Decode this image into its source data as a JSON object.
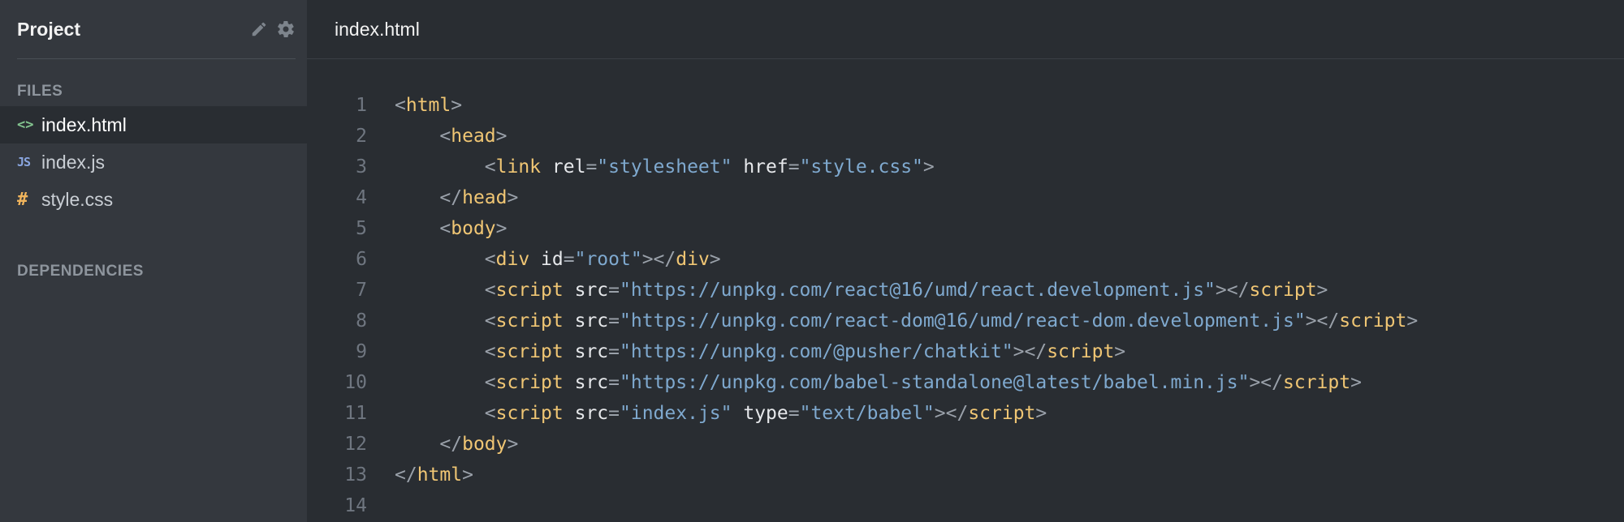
{
  "sidebar": {
    "title": "Project",
    "files_label": "FILES",
    "dependencies_label": "DEPENDENCIES",
    "files": [
      {
        "icon": "<>",
        "name": "index.html",
        "active": true
      },
      {
        "icon": "JS",
        "name": "index.js",
        "active": false
      },
      {
        "icon": "#",
        "name": "style.css",
        "active": false
      }
    ]
  },
  "editor": {
    "tab_title": "index.html",
    "lines": [
      {
        "n": "1",
        "indent": 0,
        "tokens": [
          [
            "p",
            "<"
          ],
          [
            "t",
            "html"
          ],
          [
            "p",
            ">"
          ]
        ]
      },
      {
        "n": "2",
        "indent": 1,
        "tokens": [
          [
            "p",
            "<"
          ],
          [
            "t",
            "head"
          ],
          [
            "p",
            ">"
          ]
        ]
      },
      {
        "n": "3",
        "indent": 2,
        "tokens": [
          [
            "p",
            "<"
          ],
          [
            "t",
            "link"
          ],
          [
            "p",
            " "
          ],
          [
            "a",
            "rel"
          ],
          [
            "p",
            "="
          ],
          [
            "s",
            "\"stylesheet\""
          ],
          [
            "p",
            " "
          ],
          [
            "a",
            "href"
          ],
          [
            "p",
            "="
          ],
          [
            "s",
            "\"style.css\""
          ],
          [
            "p",
            ">"
          ]
        ]
      },
      {
        "n": "4",
        "indent": 1,
        "tokens": [
          [
            "p",
            "</"
          ],
          [
            "t",
            "head"
          ],
          [
            "p",
            ">"
          ]
        ]
      },
      {
        "n": "5",
        "indent": 1,
        "tokens": [
          [
            "p",
            "<"
          ],
          [
            "t",
            "body"
          ],
          [
            "p",
            ">"
          ]
        ]
      },
      {
        "n": "6",
        "indent": 2,
        "tokens": [
          [
            "p",
            "<"
          ],
          [
            "t",
            "div"
          ],
          [
            "p",
            " "
          ],
          [
            "a",
            "id"
          ],
          [
            "p",
            "="
          ],
          [
            "s",
            "\"root\""
          ],
          [
            "p",
            "></"
          ],
          [
            "t",
            "div"
          ],
          [
            "p",
            ">"
          ]
        ]
      },
      {
        "n": "7",
        "indent": 2,
        "tokens": [
          [
            "p",
            "<"
          ],
          [
            "t",
            "script"
          ],
          [
            "p",
            " "
          ],
          [
            "a",
            "src"
          ],
          [
            "p",
            "="
          ],
          [
            "s",
            "\"https://unpkg.com/react@16/umd/react.development.js\""
          ],
          [
            "p",
            "></"
          ],
          [
            "t",
            "script"
          ],
          [
            "p",
            ">"
          ]
        ]
      },
      {
        "n": "8",
        "indent": 2,
        "tokens": [
          [
            "p",
            "<"
          ],
          [
            "t",
            "script"
          ],
          [
            "p",
            " "
          ],
          [
            "a",
            "src"
          ],
          [
            "p",
            "="
          ],
          [
            "s",
            "\"https://unpkg.com/react-dom@16/umd/react-dom.development.js\""
          ],
          [
            "p",
            "></"
          ],
          [
            "t",
            "script"
          ],
          [
            "p",
            ">"
          ]
        ]
      },
      {
        "n": "9",
        "indent": 2,
        "tokens": [
          [
            "p",
            "<"
          ],
          [
            "t",
            "script"
          ],
          [
            "p",
            " "
          ],
          [
            "a",
            "src"
          ],
          [
            "p",
            "="
          ],
          [
            "s",
            "\"https://unpkg.com/@pusher/chatkit\""
          ],
          [
            "p",
            "></"
          ],
          [
            "t",
            "script"
          ],
          [
            "p",
            ">"
          ]
        ]
      },
      {
        "n": "10",
        "indent": 2,
        "tokens": [
          [
            "p",
            "<"
          ],
          [
            "t",
            "script"
          ],
          [
            "p",
            " "
          ],
          [
            "a",
            "src"
          ],
          [
            "p",
            "="
          ],
          [
            "s",
            "\"https://unpkg.com/babel-standalone@latest/babel.min.js\""
          ],
          [
            "p",
            "></"
          ],
          [
            "t",
            "script"
          ],
          [
            "p",
            ">"
          ]
        ]
      },
      {
        "n": "11",
        "indent": 2,
        "tokens": [
          [
            "p",
            "<"
          ],
          [
            "t",
            "script"
          ],
          [
            "p",
            " "
          ],
          [
            "a",
            "src"
          ],
          [
            "p",
            "="
          ],
          [
            "s",
            "\"index.js\""
          ],
          [
            "p",
            " "
          ],
          [
            "a",
            "type"
          ],
          [
            "p",
            "="
          ],
          [
            "s",
            "\"text/babel\""
          ],
          [
            "p",
            "></"
          ],
          [
            "t",
            "script"
          ],
          [
            "p",
            ">"
          ]
        ]
      },
      {
        "n": "12",
        "indent": 1,
        "tokens": [
          [
            "p",
            "</"
          ],
          [
            "t",
            "body"
          ],
          [
            "p",
            ">"
          ]
        ]
      },
      {
        "n": "13",
        "indent": 0,
        "tokens": [
          [
            "p",
            "</"
          ],
          [
            "t",
            "html"
          ],
          [
            "p",
            ">"
          ]
        ]
      },
      {
        "n": "14",
        "indent": 0,
        "tokens": []
      }
    ]
  },
  "icons": {
    "edit": "pencil-icon",
    "settings": "gear-icon"
  }
}
